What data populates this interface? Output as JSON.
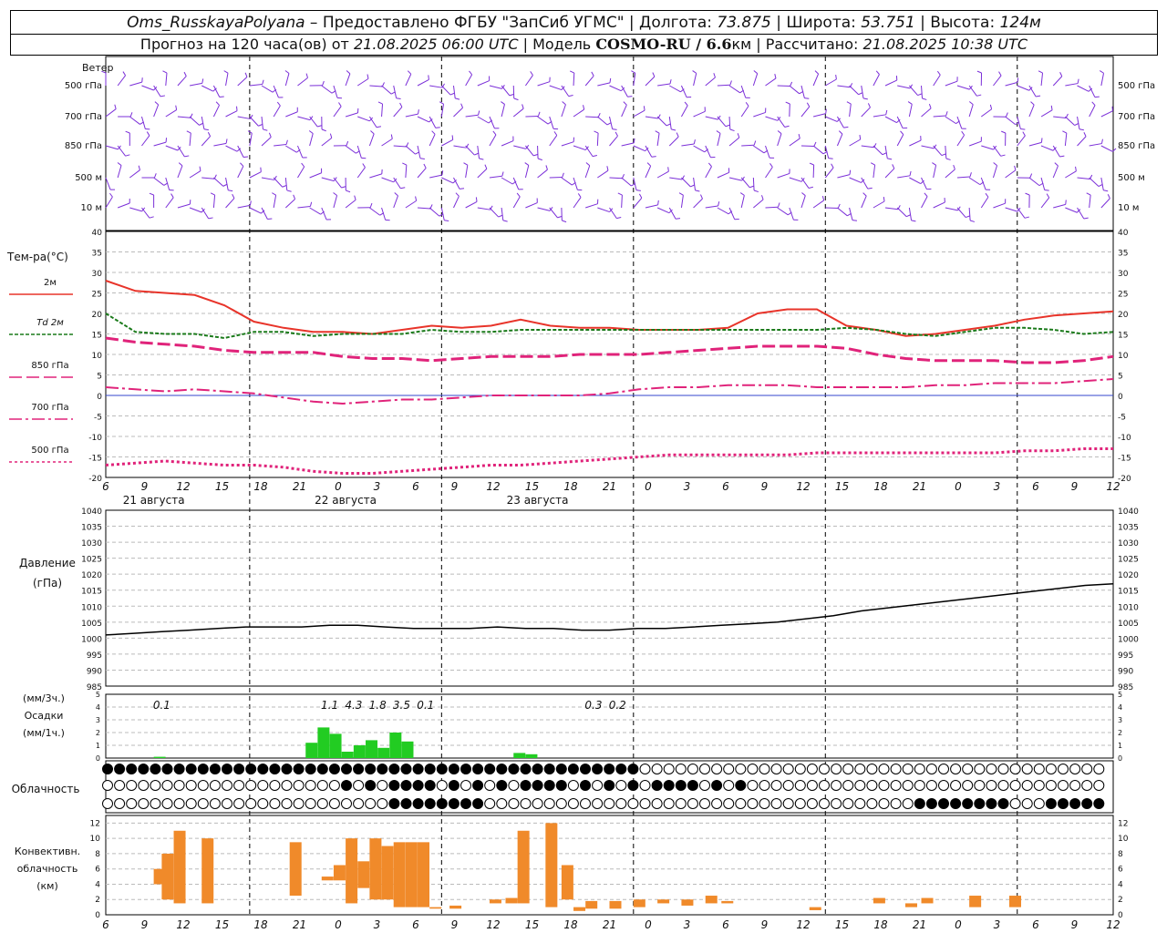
{
  "header": {
    "station": "Oms_RusskayaPolyana",
    "provider": " – Предоставлено ФГБУ \"ЗапСиб УГМС\" | Долгота: ",
    "lon": "73.875",
    "lat_label": " | Широта: ",
    "lat": "53.751",
    "alt_label": " | Высота: ",
    "alt": "124м",
    "forecast_label": "Прогноз на 120 часа(ов) от ",
    "forecast_start": "21.08.2025 06:00 UTC",
    "model_label": " | Модель ",
    "model": "COSMO-RU / 6.6",
    "model_unit": "км",
    "calc_label": " | Рассчитано: ",
    "calc_time": "21.08.2025 10:38 UTC"
  },
  "labels": {
    "wind": "Ветер",
    "wind_levels": [
      "500 гПа",
      "700 гПа",
      "850 гПа",
      "500 м",
      "10 м"
    ],
    "temp_title": "Тем-ра(°С)",
    "legend": [
      "2м",
      "Td 2м",
      "850 гПа",
      "700 гПа",
      "500 гПа"
    ],
    "pressure": [
      "Давление",
      "(гПа)"
    ],
    "precip": [
      "(мм/3ч.)",
      "Осадки",
      "(мм/1ч.)"
    ],
    "cloud": "Облачность",
    "conv": [
      "Конвективн.",
      "облачность",
      "(км)"
    ],
    "dates": [
      "21 августа",
      "22 августа",
      "23 августа"
    ]
  },
  "colors": {
    "t2m": "#e8342a",
    "td2m": "#1a7a1a",
    "t850": "#e0237a",
    "t700": "#e0237a",
    "t500": "#e0237a",
    "wind": "#7b2fd8",
    "precip": "#22cc22",
    "conv": "#f08a2a",
    "grid": "#888888"
  },
  "chart_data": [
    {
      "type": "line",
      "title": "Тем-ра(°С)",
      "ylim": [
        -20,
        40
      ],
      "x_ticks": [
        "6",
        "9",
        "12",
        "15",
        "18",
        "21",
        "0",
        "3",
        "6",
        "9",
        "12",
        "15",
        "18",
        "21",
        "0",
        "3",
        "6",
        "9",
        "12",
        "15",
        "18",
        "21",
        "0",
        "3",
        "6",
        "9",
        "12"
      ],
      "series": [
        {
          "name": "2м",
          "values": [
            28,
            25.5,
            25,
            24.5,
            22,
            18,
            16.5,
            15.5,
            15.5,
            15,
            16,
            17,
            16.5,
            17,
            18.5,
            17,
            16.5,
            16.5,
            16,
            16,
            16,
            16.5,
            20,
            21,
            21,
            17,
            16,
            14.5,
            15,
            16,
            17,
            18.5,
            19.5,
            20,
            20.5
          ]
        },
        {
          "name": "Td 2м",
          "values": [
            20,
            15.5,
            15,
            15,
            14,
            15.5,
            15.5,
            14.5,
            15,
            15,
            15,
            16,
            15.5,
            15.5,
            16,
            16,
            16,
            16,
            16,
            16,
            16,
            16,
            16,
            16,
            16,
            16.5,
            16,
            15,
            14.5,
            15.5,
            16.5,
            16.5,
            16,
            15,
            15.5
          ]
        },
        {
          "name": "850 гПа",
          "values": [
            14,
            13,
            12.5,
            12,
            11,
            10.5,
            10.5,
            10.5,
            9.5,
            9,
            9,
            8.5,
            9,
            9.5,
            9.5,
            9.5,
            10,
            10,
            10,
            10.5,
            11,
            11.5,
            12,
            12,
            12,
            11.5,
            10,
            9,
            8.5,
            8.5,
            8.5,
            8,
            8,
            8.5,
            9.5
          ]
        },
        {
          "name": "700 гПа",
          "values": [
            2,
            1.5,
            1,
            1.5,
            1,
            0.5,
            -0.5,
            -1.5,
            -2,
            -1.5,
            -1,
            -1,
            -0.5,
            0,
            0,
            0,
            0,
            0.5,
            1.5,
            2,
            2,
            2.5,
            2.5,
            2.5,
            2,
            2,
            2,
            2,
            2.5,
            2.5,
            3,
            3,
            3,
            3.5,
            4
          ]
        },
        {
          "name": "500 гПа",
          "values": [
            -17,
            -16.5,
            -16,
            -16.5,
            -17,
            -17,
            -17.5,
            -18.5,
            -19,
            -19,
            -18.5,
            -18,
            -17.5,
            -17,
            -17,
            -16.5,
            -16,
            -15.5,
            -15,
            -14.5,
            -14.5,
            -14.5,
            -14.5,
            -14.5,
            -14,
            -14,
            -14,
            -14,
            -14,
            -14,
            -14,
            -13.5,
            -13.5,
            -13,
            -13
          ]
        }
      ]
    },
    {
      "type": "line",
      "title": "Давление (гПа)",
      "ylim": [
        985,
        1040
      ],
      "series": [
        {
          "name": "Давление",
          "values": [
            1001,
            1001.5,
            1002,
            1002.5,
            1003,
            1003.5,
            1003.5,
            1003.5,
            1004,
            1004,
            1003.5,
            1003,
            1003,
            1003,
            1003.5,
            1003,
            1003,
            1002.5,
            1002.5,
            1003,
            1003,
            1003.5,
            1004,
            1004.5,
            1005,
            1006,
            1007,
            1008.5,
            1009.5,
            1010.5,
            1011.5,
            1012.5,
            1013.5,
            1014.5,
            1015.5,
            1016.5,
            1017
          ]
        }
      ]
    },
    {
      "type": "bar",
      "title": "Осадки",
      "ylim": [
        0,
        5
      ],
      "x_positions": [
        6,
        7,
        25,
        26.5,
        28,
        29.5,
        31,
        32.5,
        34,
        35.5,
        37,
        51,
        52.5
      ],
      "values": [
        0.1,
        0,
        1.2,
        2.4,
        1.9,
        0.5,
        1,
        1.4,
        0.8,
        2,
        1.3,
        0.4,
        0.3
      ],
      "labels": [
        {
          "h": 7,
          "text": "0.1"
        },
        {
          "h": 28,
          "text": "1.1"
        },
        {
          "h": 31,
          "text": "4.3"
        },
        {
          "h": 34,
          "text": "1.8"
        },
        {
          "h": 37,
          "text": "3.5"
        },
        {
          "h": 40,
          "text": "0.1"
        },
        {
          "h": 61,
          "text": "0.3"
        },
        {
          "h": 64,
          "text": "0.2"
        }
      ]
    },
    {
      "type": "bar",
      "title": "Конвективн. облачность (км)",
      "ylim": [
        0,
        13
      ],
      "bars": [
        {
          "h": 6,
          "lo": 4,
          "hi": 6
        },
        {
          "h": 7,
          "lo": 2,
          "hi": 8
        },
        {
          "h": 8.5,
          "lo": 1.5,
          "hi": 11
        },
        {
          "h": 12,
          "lo": 1.5,
          "hi": 10
        },
        {
          "h": 23,
          "lo": 2.5,
          "hi": 9.5
        },
        {
          "h": 27,
          "lo": 4.5,
          "hi": 5
        },
        {
          "h": 28.5,
          "lo": 4.5,
          "hi": 6.5
        },
        {
          "h": 30,
          "lo": 1.5,
          "hi": 10
        },
        {
          "h": 31.5,
          "lo": 3.5,
          "hi": 7
        },
        {
          "h": 33,
          "lo": 2,
          "hi": 10
        },
        {
          "h": 34.5,
          "lo": 2,
          "hi": 9
        },
        {
          "h": 36,
          "lo": 1,
          "hi": 9.5
        },
        {
          "h": 37.5,
          "lo": 1,
          "hi": 9.5
        },
        {
          "h": 39,
          "lo": 1,
          "hi": 9.5
        },
        {
          "h": 40.5,
          "lo": 0.8,
          "hi": 1
        },
        {
          "h": 43,
          "lo": 0.8,
          "hi": 1.2
        },
        {
          "h": 48,
          "lo": 1.5,
          "hi": 2
        },
        {
          "h": 50,
          "lo": 1.5,
          "hi": 2.2
        },
        {
          "h": 51.5,
          "lo": 1.5,
          "hi": 11
        },
        {
          "h": 55,
          "lo": 1,
          "hi": 12
        },
        {
          "h": 57,
          "lo": 2,
          "hi": 6.5
        },
        {
          "h": 58.5,
          "lo": 0.5,
          "hi": 1
        },
        {
          "h": 60,
          "lo": 0.8,
          "hi": 1.8
        },
        {
          "h": 63,
          "lo": 0.8,
          "hi": 1.8
        },
        {
          "h": 66,
          "lo": 1,
          "hi": 2
        },
        {
          "h": 69,
          "lo": 1.5,
          "hi": 2
        },
        {
          "h": 72,
          "lo": 1.2,
          "hi": 2
        },
        {
          "h": 75,
          "lo": 1.5,
          "hi": 2.5
        },
        {
          "h": 77,
          "lo": 1.5,
          "hi": 1.8
        },
        {
          "h": 88,
          "lo": 0.6,
          "hi": 1
        },
        {
          "h": 96,
          "lo": 1.5,
          "hi": 2.2
        },
        {
          "h": 100,
          "lo": 1,
          "hi": 1.5
        },
        {
          "h": 102,
          "lo": 1.5,
          "hi": 2.2
        },
        {
          "h": 108,
          "lo": 1,
          "hi": 2.5
        },
        {
          "h": 113,
          "lo": 1,
          "hi": 2.5
        }
      ]
    }
  ]
}
